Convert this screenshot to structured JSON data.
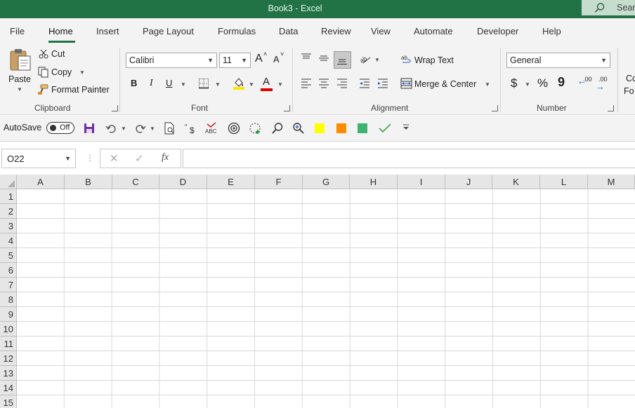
{
  "window": {
    "title": "Book3  -  Excel",
    "search_label": "Sear"
  },
  "menu_tabs": [
    "File",
    "Home",
    "Insert",
    "Page Layout",
    "Formulas",
    "Data",
    "Review",
    "View",
    "Automate",
    "Developer",
    "Help"
  ],
  "active_tab": "Home",
  "clipboard": {
    "paste": "Paste",
    "cut": "Cut",
    "copy": "Copy",
    "format_painter": "Format Painter",
    "group": "Clipboard"
  },
  "font": {
    "name": "Calibri",
    "size": "11",
    "bold": "B",
    "italic": "I",
    "underline": "U",
    "grow": "A",
    "shrink": "A",
    "font_color_letter": "A",
    "group": "Font"
  },
  "alignment": {
    "wrap_text": "Wrap Text",
    "merge_center": "Merge & Center",
    "group": "Alignment"
  },
  "number": {
    "format": "General",
    "currency": "$",
    "percent": "%",
    "comma": "9",
    "inc_decimal": ".00",
    "dec_decimal": ".00",
    "group": "Number"
  },
  "styles_partial": {
    "line1": "Co",
    "line2": "Fo"
  },
  "qat": {
    "autosave": "AutoSave",
    "autosave_state": "Off"
  },
  "formula_bar": {
    "name_box": "O22",
    "fx": "fx",
    "value": ""
  },
  "columns": [
    "A",
    "B",
    "C",
    "D",
    "E",
    "F",
    "G",
    "H",
    "I",
    "J",
    "K",
    "L",
    "M"
  ],
  "rows": [
    "1",
    "2",
    "3",
    "4",
    "5",
    "6",
    "7",
    "8",
    "9",
    "10",
    "11",
    "12",
    "13",
    "14",
    "15"
  ],
  "colors": {
    "excel_green": "#217346",
    "yellow": "#FFFF00",
    "orange": "#FF8C00",
    "green_square": "#3CB371",
    "font_red": "#E00000",
    "highlight_yellow": "#FFE600"
  }
}
